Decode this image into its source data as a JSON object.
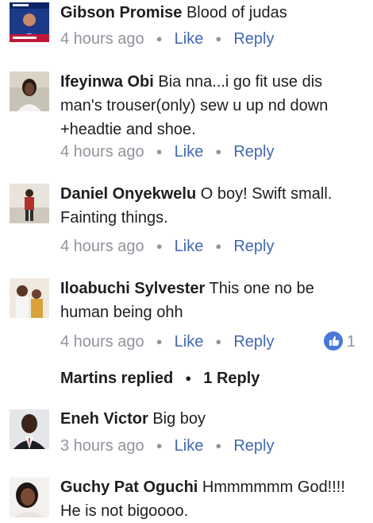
{
  "comments": [
    {
      "author": "Gibson Promise",
      "text": "Blood of judas",
      "time": "4 hours ago",
      "like_label": "Like",
      "reply_label": "Reply",
      "avatar_icon": "news-thumbnail-avatar"
    },
    {
      "author": "Ifeyinwa Obi",
      "text": "Bia nna...i go fit use dis man's trouser(only) sew u up nd down +headtie and shoe.",
      "time": "4 hours ago",
      "like_label": "Like",
      "reply_label": "Reply",
      "avatar_icon": "woman-portrait-avatar"
    },
    {
      "author": "Daniel Onyekwelu",
      "text": "O boy! Swift small. Fainting things.",
      "time": "4 hours ago",
      "like_label": "Like",
      "reply_label": "Reply",
      "avatar_icon": "man-standing-avatar"
    },
    {
      "author": "Iloabuchi Sylvester",
      "text": "This one no be human being ohh",
      "time": "4 hours ago",
      "like_label": "Like",
      "reply_label": "Reply",
      "avatar_icon": "couple-photo-avatar",
      "like_count": "1",
      "replies": {
        "name": "Martins replied",
        "count": "1 Reply"
      }
    },
    {
      "author": "Eneh Victor",
      "text": "Big boy",
      "time": "3 hours ago",
      "like_label": "Like",
      "reply_label": "Reply",
      "avatar_icon": "man-suit-avatar"
    },
    {
      "author": "Guchy Pat Oguchi",
      "text": "Hmmmmmm God!!!! He is not bigoooo.",
      "avatar_icon": "woman-selfie-avatar"
    }
  ],
  "colors": {
    "link": "#4267b2",
    "meta": "#90949c",
    "like_badge": "#4a78d8"
  }
}
